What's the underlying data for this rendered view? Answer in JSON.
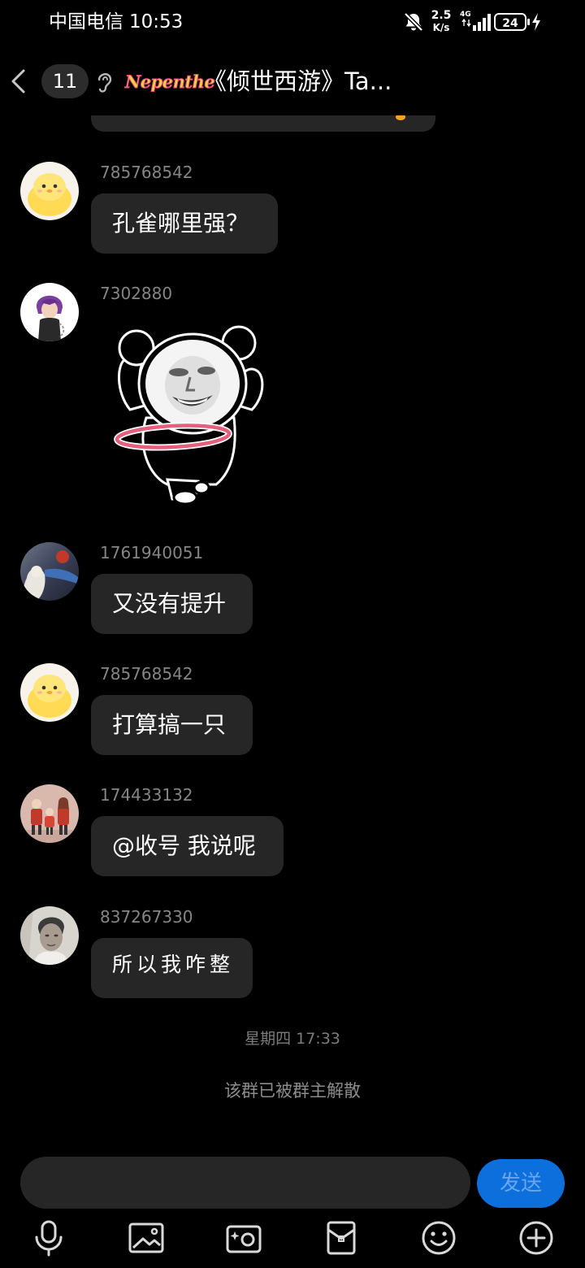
{
  "status_bar": {
    "carrier": "中国电信",
    "time": "10:53",
    "speed_value": "2.5",
    "speed_unit": "K/s",
    "network": "4G",
    "battery": "24",
    "icons": [
      "mute-icon",
      "signal-icon",
      "battery-icon",
      "charging-icon"
    ]
  },
  "header": {
    "icons": [
      "back-icon",
      "ear-icon"
    ],
    "unread_count": "11",
    "group_tag": "Nepenthe",
    "title": "《倾世西游》Ta..."
  },
  "messages": [
    {
      "sender": "785768542",
      "text": "孔雀哪里强？"
    },
    {
      "sender": "7302880",
      "sticker_icon": "panda-sticker-icon"
    },
    {
      "sender": "1761940051",
      "text": "又没有提升"
    },
    {
      "sender": "785768542",
      "text": "打算搞一只"
    },
    {
      "sender": "174433132",
      "text": "@收号 我说呢"
    },
    {
      "sender": "837267330",
      "text": "所以我咋整"
    }
  ],
  "timestamp": "星期四 17:33",
  "system_notice": "该群已被群主解散",
  "composer": {
    "send_label": "发送"
  },
  "toolbar": {
    "icons": [
      "mic-icon",
      "image-icon",
      "camera-icon",
      "red-packet-icon",
      "emoji-icon",
      "plus-icon"
    ]
  },
  "colors": {
    "background": "#000000",
    "bubble": "#262626",
    "accent": "#0c6fdb"
  }
}
